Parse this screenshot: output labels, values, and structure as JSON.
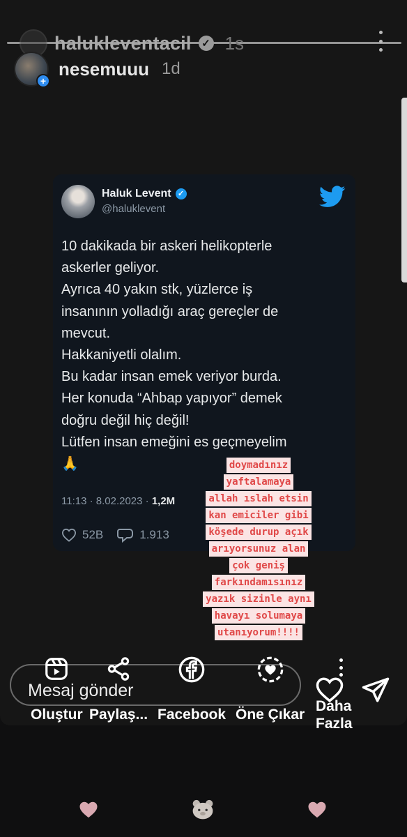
{
  "story": {
    "ghost_username": "halukleventacil",
    "ghost_time": "1s",
    "username": "nesemuuu",
    "time": "1d"
  },
  "tweet": {
    "name": "Haluk Levent",
    "handle": "@haluklevent",
    "lines": [
      "10 dakikada bir askeri helikopterle",
      "askerler geliyor.",
      "Ayrıca 40 yakın stk, yüzlerce iş",
      "insanının yolladığı araç gereçler de",
      "mevcut.",
      "Hakkaniyetli olalım.",
      "Bu kadar insan emek veriyor burda.",
      "Her konuda “Ahbap yapıyor” demek",
      "doğru değil hiç değil!",
      "Lütfen insan emeğini es geçmeyelim",
      "🙏"
    ],
    "timestamp": "11:13 · 8.02.2023 · ",
    "views": "1,2M",
    "likes": "52B",
    "replies": "1.913"
  },
  "annotation": [
    "doymadınız",
    "yaftalamaya",
    "allah ıslah etsin",
    "kan emiciler gibi",
    "köşede durup açık",
    "arıyorsunuz alan",
    "çok geniş",
    "farkındamısınız",
    "yazık sizinle aynı",
    "havayı solumaya",
    "utanıyorum!!!!"
  ],
  "actions": {
    "message_placeholder": "Mesaj gönder",
    "create": "Oluştur",
    "share": "Paylaş...",
    "facebook": "Facebook",
    "highlight": "Öne Çıkar",
    "more": "Daha Fazla"
  },
  "colors": {
    "twitter_blue": "#1d9bf0",
    "annotation_red": "#e04848",
    "annotation_bg": "#fbe4e4",
    "reaction_pink": "#d9a9b1"
  }
}
